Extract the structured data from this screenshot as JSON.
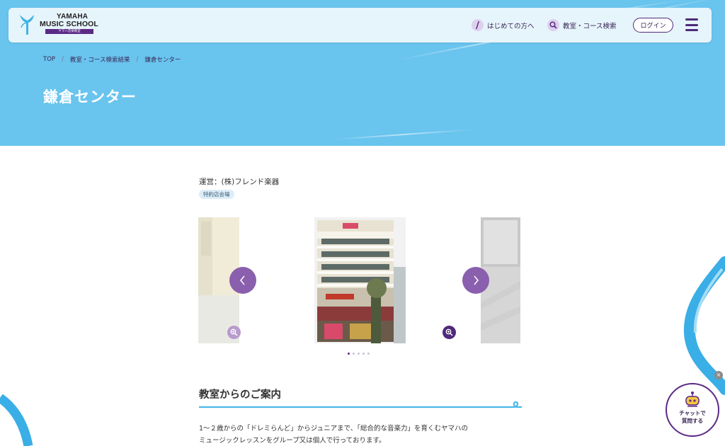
{
  "header": {
    "logo_line1": "YAMAHA",
    "logo_line2": "MUSIC SCHOOL",
    "logo_sub": "ヤマハ音楽教室",
    "nav": [
      {
        "label": "はじめての方へ",
        "icon": "info-icon"
      },
      {
        "label": "教室・コース検索",
        "icon": "search-icon"
      }
    ],
    "login_label": "ログイン",
    "menu_icon": "hamburger-menu-icon"
  },
  "breadcrumb": [
    "TOP",
    "教室・コース検索結果",
    "鎌倉センター"
  ],
  "page_title": "鎌倉センター",
  "operator": "運営：(株)フレンド楽器",
  "tag": "特約店会場",
  "carousel": {
    "prev_icon": "chevron-left-icon",
    "next_icon": "chevron-right-icon",
    "zoom_icon": "zoom-in-icon",
    "slide_count": 5,
    "active_index": 0
  },
  "section": {
    "title": "教室からのご案内",
    "body_lines": [
      "1～２歳からの「ドレミらんど」からジュニアまで、「総合的な音楽力」を育くむヤマハの",
      "ミュージックレッスンをグループ又は個人で行っております。"
    ]
  },
  "chat": {
    "label_line1": "チャットで",
    "label_line2": "質問する",
    "close_label": "×",
    "icon": "robot-icon"
  },
  "colors": {
    "hero": "#69c4ee",
    "primary": "#5b2a86",
    "arrow": "#8a5fae",
    "accent_line": "#4bb8e8"
  }
}
